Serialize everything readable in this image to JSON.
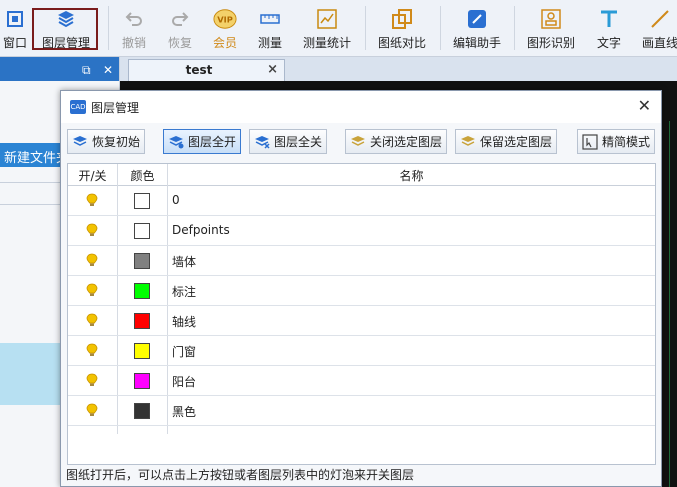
{
  "toolbar": {
    "items": [
      {
        "label": "窗口",
        "icon": "window-icon"
      },
      {
        "label": "图层管理",
        "icon": "layers-icon"
      },
      {
        "label": "撤销",
        "icon": "undo-icon"
      },
      {
        "label": "恢复",
        "icon": "redo-icon"
      },
      {
        "label": "会员",
        "icon": "vip-icon"
      },
      {
        "label": "测量",
        "icon": "ruler-icon"
      },
      {
        "label": "测量统计",
        "icon": "measure-stats-icon"
      },
      {
        "label": "图纸对比",
        "icon": "compare-icon"
      },
      {
        "label": "编辑助手",
        "icon": "edit-assistant-icon"
      },
      {
        "label": "图形识别",
        "icon": "shape-recognition-icon"
      },
      {
        "label": "文字",
        "icon": "text-icon"
      },
      {
        "label": "画直线",
        "icon": "line-icon"
      }
    ],
    "vip_text": "VIP"
  },
  "left_panel": {
    "new_file_label": "新建文件夹"
  },
  "tab": {
    "title": "test",
    "close": "×"
  },
  "dialog": {
    "title": "图层管理",
    "app_icon_text": "CAD",
    "close": "✕",
    "buttons": [
      {
        "label": "恢复初始"
      },
      {
        "label": "图层全开"
      },
      {
        "label": "图层全关"
      },
      {
        "label": "关闭选定图层"
      },
      {
        "label": "保留选定图层"
      },
      {
        "label": "精简模式"
      }
    ],
    "columns": {
      "toggle": "开/关",
      "color": "颜色",
      "name": "名称"
    },
    "layers": [
      {
        "name": "0",
        "color": "#ffffff"
      },
      {
        "name": "Defpoints",
        "color": "#ffffff"
      },
      {
        "name": "墙体",
        "color": "#808080"
      },
      {
        "name": "标注",
        "color": "#00ff00"
      },
      {
        "name": "轴线",
        "color": "#ff0000"
      },
      {
        "name": "门窗",
        "color": "#ffff00"
      },
      {
        "name": "阳台",
        "color": "#ff00ff"
      },
      {
        "name": "黑色",
        "color": "#333333"
      }
    ],
    "status": "图纸打开后，可以点击上方按钮或者图层列表中的灯泡来开关图层"
  },
  "colors": {
    "accent": "#2b73c5",
    "active_outline": "#7a1c1c",
    "bulb": "#f2c200"
  }
}
